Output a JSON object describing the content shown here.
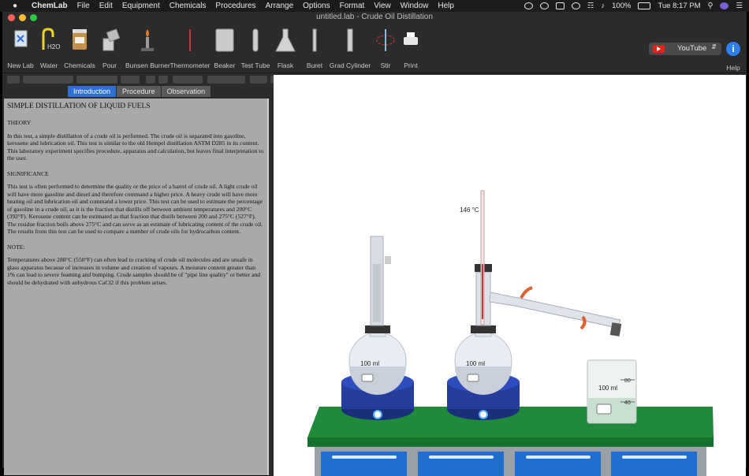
{
  "menubar": {
    "items": [
      "ChemLab",
      "File",
      "Edit",
      "Equipment",
      "Chemicals",
      "Procedures",
      "Arrange",
      "Options",
      "Format",
      "View",
      "Window",
      "Help"
    ],
    "battery": "100%",
    "clock": "Tue 8:17 PM"
  },
  "window": {
    "title": "untitled.lab - Crude Oil Distillation"
  },
  "toolbar": {
    "items": [
      "New Lab",
      "Water",
      "Chemicals",
      "Pour",
      "Bunsen Burner",
      "Thermometer",
      "Beaker",
      "Test Tube",
      "Flask",
      "Buret",
      "Grad Cylinder",
      "Stir",
      "Print"
    ],
    "water_formula": "H2O",
    "youtube": "YouTube",
    "help": "Help"
  },
  "tabs": [
    "Introduction",
    "Procedure",
    "Observation"
  ],
  "active_tab": "Introduction",
  "document": {
    "title": "SIMPLE DISTILLATION OF LIQUID FUELS",
    "theory_heading": "THEORY",
    "theory_text": "In this test, a simple distillation of a crude oil is performed.  The crude oil is separated into gasoline, kerosene and lubrication oil.  This test is similar to the old Hempel distillation ASTM D285 in its content.  This laboratory experiment specifies procedure, apparatus and calculation, but leaves final interpretation to the user.",
    "significance_heading": "SIGNIFICANCE",
    "significance_text": "This test is often performed to determine the quality or the price of a barrel of crude oil.  A light crude oil will have more gasoline and diesel and therefore command a higher price.  A heavy crude will have more heating oil and lubrication oil and command a lower price.  This test can be used to estimate the percentage of gasoline in a crude oil, as it is the fraction that distills off between ambient temperatures and 200°C (392°F).  Kerosene content can be estimated as that fraction that distils between 200 and 275°C (527°F).  The residue fraction boils above 275°C and can serve as an estimate of lubricating content of the crude oil. The results from this test can be used to compare a number of crude oils for hydrocarbon content.",
    "note_heading": "NOTE:",
    "note_text": "Temperatures above 288°C (550°F) can often lead to cracking of crude oil molecules and are unsafe in glass apparatus because of increases in volume and creation of vapours.  A moisture content greater than 1% can lead to severe foaming and bumping.  Crude samples should be of \"pipe line quality\" or better and should be dehydrated with anhydrous CaCl2  if this problem arises."
  },
  "lab": {
    "thermometer_reading": "146 °C",
    "flask1_label": "100 ml",
    "flask2_label": "100 ml",
    "beaker_label": "100 ml",
    "beaker_marks": [
      "80",
      "40"
    ]
  },
  "colors": {
    "accent": "#2d6fd4",
    "bench_top": "#1e8a3a",
    "hotplate": "#253e9c",
    "drawer": "#1f6fcf"
  }
}
